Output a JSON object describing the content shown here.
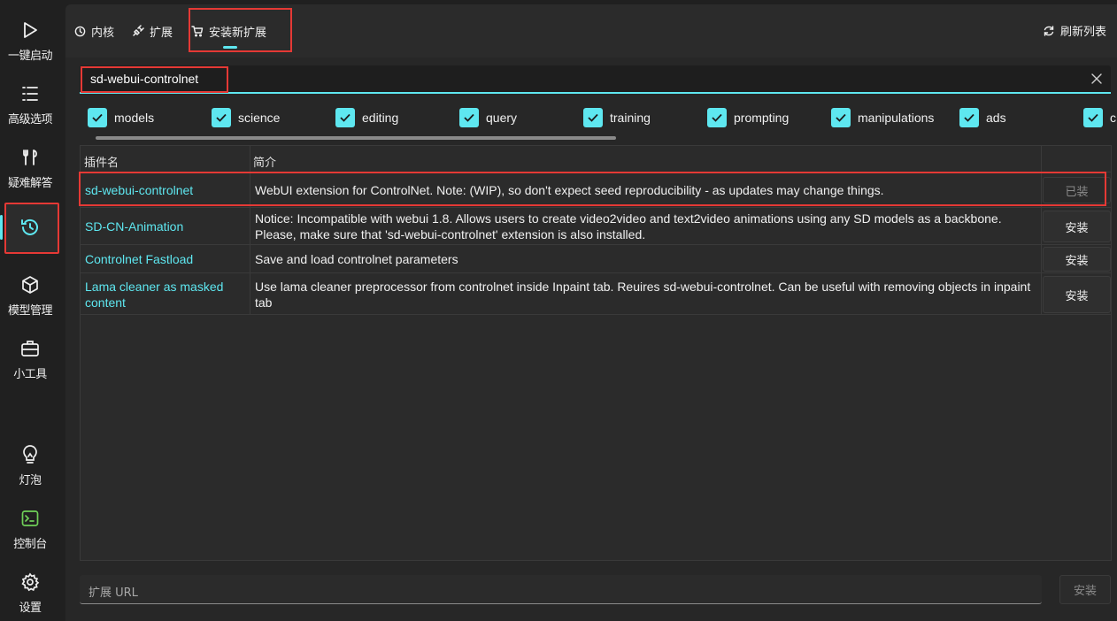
{
  "sidebar": {
    "items": [
      {
        "label": "一键启动",
        "icon": "play-icon"
      },
      {
        "label": "高级选项",
        "icon": "list-icon"
      },
      {
        "label": "疑难解答",
        "icon": "tools-icon"
      },
      {
        "label": "",
        "icon": "history-icon"
      },
      {
        "label": "模型管理",
        "icon": "cube-icon"
      },
      {
        "label": "小工具",
        "icon": "toolbox-icon"
      },
      {
        "label": "灯泡",
        "icon": "lightbulb-icon"
      },
      {
        "label": "控制台",
        "icon": "terminal-icon"
      },
      {
        "label": "设置",
        "icon": "gear-icon"
      }
    ]
  },
  "tabs": {
    "core": "内核",
    "extensions": "扩展",
    "install": "安装新扩展",
    "refresh": "刷新列表"
  },
  "search": {
    "value": "sd-webui-controlnet"
  },
  "filters": [
    "models",
    "science",
    "editing",
    "query",
    "training",
    "prompting",
    "manipulations",
    "ads",
    "c"
  ],
  "table": {
    "headers": {
      "name": "插件名",
      "desc": "简介"
    },
    "rows": [
      {
        "name": "sd-webui-controlnet",
        "desc": "WebUI extension for ControlNet. Note: (WIP), so don't expect seed reproducibility - as updates may change things.",
        "action": "已装"
      },
      {
        "name": "SD-CN-Animation",
        "desc": "Notice: Incompatible with webui 1.8.   Allows users to create video2video and text2video animations using any SD models as a backbone. Please, make sure that 'sd-webui-controlnet' extension is also installed.",
        "action": "安装"
      },
      {
        "name": "Controlnet Fastload",
        "desc": "Save and load controlnet parameters",
        "action": "安装"
      },
      {
        "name": "Lama cleaner as masked content",
        "desc": "Use lama cleaner preprocessor from controlnet inside Inpaint tab. Reuires sd-webui-controlnet. Can be useful with removing objects in inpaint tab",
        "action": "安装"
      }
    ]
  },
  "url": {
    "placeholder": "扩展 URL",
    "button": "安装"
  },
  "colors": {
    "accent": "#5ee7f0",
    "highlight": "#e53935"
  }
}
